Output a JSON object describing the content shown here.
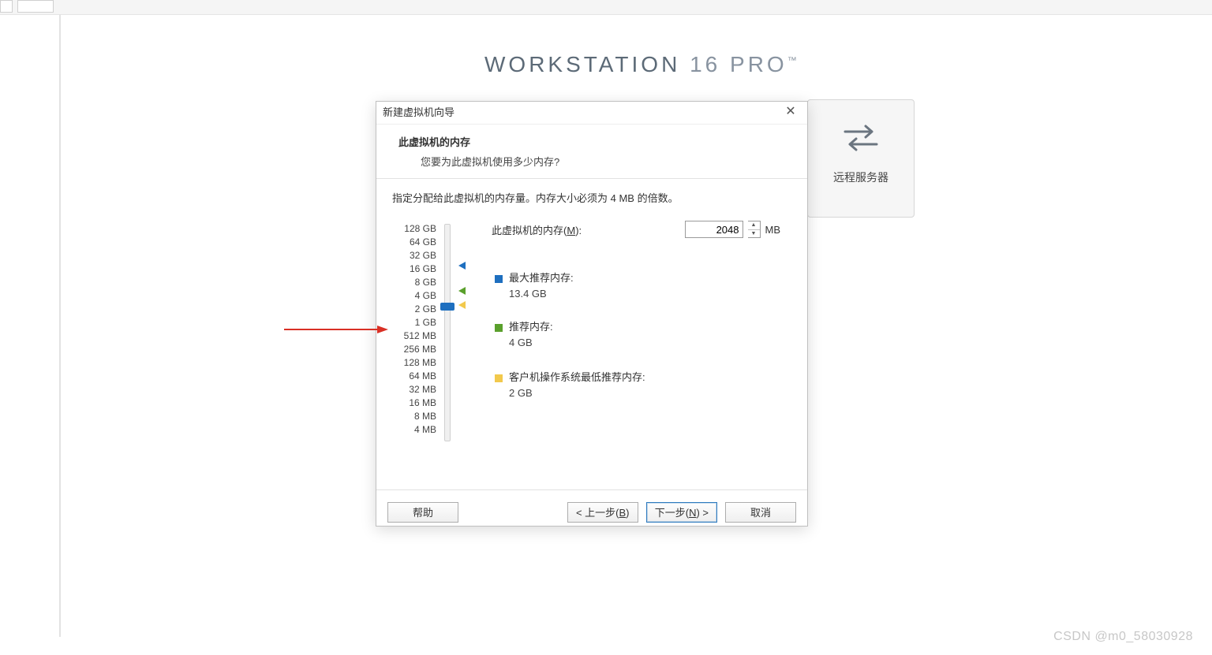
{
  "brand": {
    "text_main": "WORKSTATION ",
    "text_ver": "16 ",
    "text_edition": "PRO",
    "tm": "™"
  },
  "side_card": {
    "label": "远程服务器"
  },
  "dialog": {
    "title": "新建虚拟机向导",
    "heading": "此虚拟机的内存",
    "subheading": "您要为此虚拟机使用多少内存?",
    "instruction": "指定分配给此虚拟机的内存量。内存大小必须为 4 MB 的倍数。",
    "memory_label_pre": "此虚拟机的内存(",
    "memory_label_u": "M",
    "memory_label_post": "):",
    "memory_value": "2048",
    "memory_unit": "MB",
    "ticks": [
      "128 GB",
      "64 GB",
      "32 GB",
      "16 GB",
      "8 GB",
      "4 GB",
      "2 GB",
      "1 GB",
      "512 MB",
      "256 MB",
      "128 MB",
      "64 MB",
      "32 MB",
      "16 MB",
      "8 MB",
      "4 MB"
    ],
    "legend_max_label": "最大推荐内存:",
    "legend_max_value": "13.4 GB",
    "legend_rec_label": "推荐内存:",
    "legend_rec_value": "4 GB",
    "legend_min_label": "客户机操作系统最低推荐内存:",
    "legend_min_value": "2 GB",
    "btn_help": "帮助",
    "btn_back_pre": "< 上一步(",
    "btn_back_u": "B",
    "btn_back_post": ")",
    "btn_next_pre": "下一步(",
    "btn_next_u": "N",
    "btn_next_post": ") >",
    "btn_cancel": "取消"
  },
  "watermark": "CSDN @m0_58030928"
}
